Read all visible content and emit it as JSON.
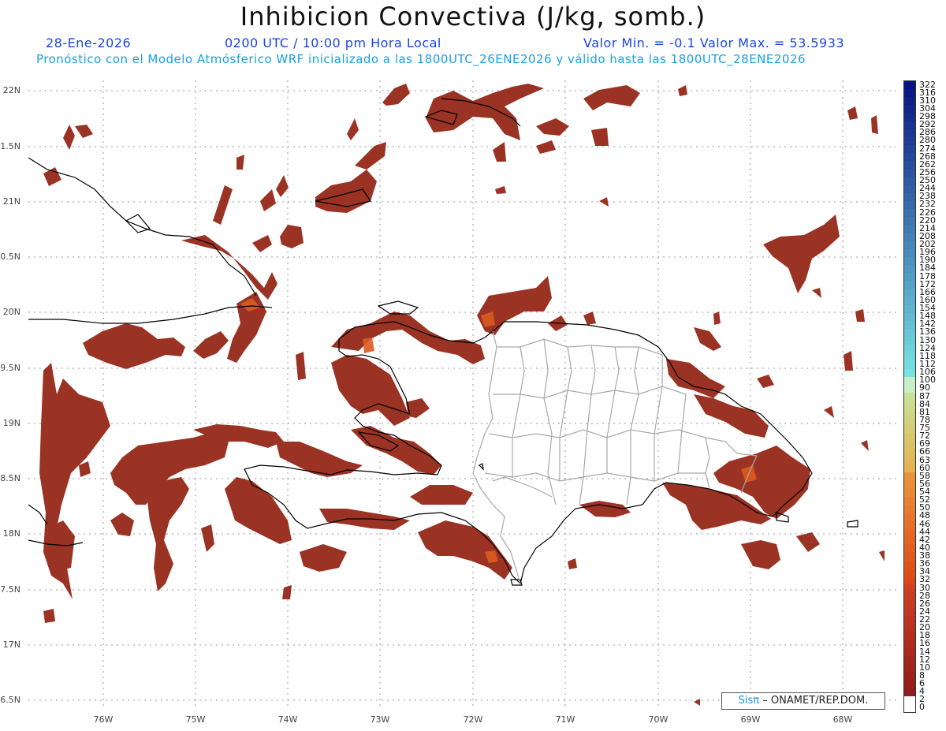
{
  "title": "Inhibicion Convectiva (J/kg, somb.)",
  "date": "28-Ene-2026",
  "time": "0200 UTC / 10:00 pm Hora Local",
  "minmax": "Valor Min. = -0.1  Valor Max. = 53.5933",
  "forecast_line": "Pronóstico con el Modelo Atmósferico WRF inicializado a las 1800UTC_26ENE2026 y válido hasta las  1800UTC_28ENE2026",
  "lat_labels": [
    "22N",
    "1.5N",
    "21N",
    "0.5N",
    "20N",
    "9.5N",
    "19N",
    "8.5N",
    "18N",
    "7.5N",
    "17N",
    "6.5N"
  ],
  "lon_labels": [
    "76W",
    "75W",
    "74W",
    "73W",
    "72W",
    "71W",
    "70W",
    "69W",
    "68W"
  ],
  "colorbar_labels": [
    "322",
    "316",
    "310",
    "304",
    "298",
    "292",
    "286",
    "280",
    "274",
    "268",
    "262",
    "256",
    "250",
    "244",
    "238",
    "232",
    "226",
    "220",
    "214",
    "208",
    "202",
    "196",
    "190",
    "184",
    "178",
    "172",
    "166",
    "160",
    "154",
    "148",
    "142",
    "136",
    "130",
    "124",
    "118",
    "112",
    "106",
    "100",
    "90",
    "87",
    "84",
    "81",
    "78",
    "75",
    "72",
    "69",
    "66",
    "63",
    "60",
    "58",
    "56",
    "54",
    "52",
    "50",
    "48",
    "46",
    "44",
    "42",
    "40",
    "38",
    "36",
    "34",
    "32",
    "30",
    "28",
    "26",
    "24",
    "22",
    "20",
    "18",
    "16",
    "14",
    "12",
    "10",
    "8",
    "6",
    "4",
    "2",
    "0"
  ],
  "credit": {
    "brand": "Sisπ",
    "text": "– ONAMET/REP.DOM."
  },
  "colors": {
    "fill_main": "#9a3324",
    "fill_highlight": "#dd5a20",
    "coast": "#000000",
    "provinces": "#a0a0a0",
    "grid": "#999999"
  }
}
